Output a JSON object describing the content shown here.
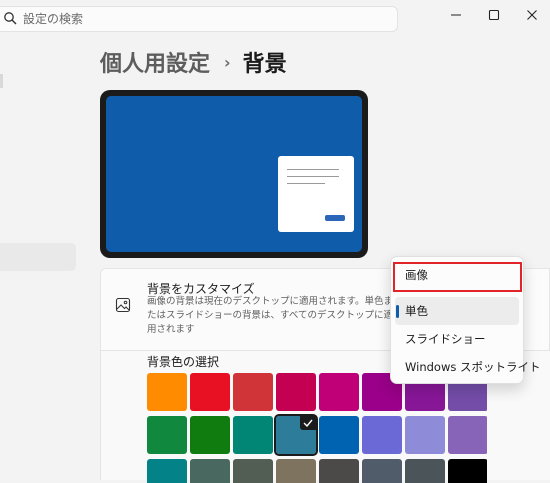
{
  "search": {
    "placeholder": "設定の検索"
  },
  "window_controls": [
    {
      "name": "minimize-button",
      "icon": "minimize-icon"
    },
    {
      "name": "maximize-button",
      "icon": "maximize-icon"
    },
    {
      "name": "close-button",
      "icon": "close-icon"
    }
  ],
  "breadcrumb": {
    "parent": "個人用設定",
    "separator": "›",
    "current": "背景"
  },
  "customize_card": {
    "icon": "image-icon",
    "title": "背景をカスタマイズ",
    "description": "画像の背景は現在のデスクトップに適用されます。単色またはスライドショーの背景は、すべてのデスクトップに適用されます"
  },
  "color_section": {
    "label": "背景色の選択",
    "selected_index": 11,
    "swatches": [
      "#ff8c00",
      "#e81123",
      "#d13438",
      "#c30052",
      "#bf0077",
      "#9a0089",
      "#881798",
      "#744da9",
      "#10893e",
      "#107c10",
      "#018574",
      "#2d7d9a",
      "#0063b1",
      "#6b69d6",
      "#8e8cd8",
      "#8764b8",
      "#038387",
      "#486860",
      "#525e54",
      "#7e735f",
      "#4c4a48",
      "#515c6b",
      "#4a5459",
      "#000000"
    ]
  },
  "dropdown": {
    "selected_index": 1,
    "highlighted_index": 0,
    "options": [
      "画像",
      "単色",
      "スライドショー",
      "Windows スポットライト"
    ]
  },
  "colors": {
    "accent": "#0f5cab",
    "highlight": "#e0242a"
  }
}
